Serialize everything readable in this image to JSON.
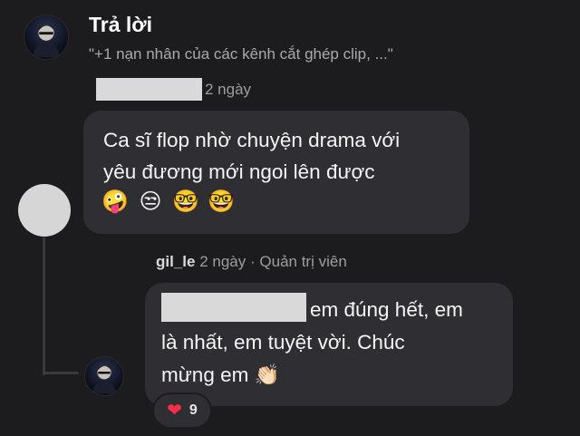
{
  "header": {
    "title": "Trả lời",
    "subtitle": "\"+1 nạn nhân của các kênh cắt ghép clip, ...\""
  },
  "comment": {
    "time": "2 ngày",
    "text_line1": "Ca sĩ flop nhờ chuyện drama với",
    "text_line2": "yêu đương mới ngoi lên được",
    "emojis": [
      "🤪",
      "😒",
      "🤓",
      "🤓"
    ]
  },
  "reply": {
    "username": "gil_le",
    "time": "2 ngày",
    "separator": "·",
    "role": "Quản trị viên",
    "text_line1": "em đúng hết, em",
    "text_line2": "là nhất, em tuyệt vời. Chúc",
    "text_line3": "mừng em",
    "emoji": "👏🏻",
    "reactions": {
      "icon": "heart-icon",
      "heart": "❤",
      "count": "9",
      "color": "#ff2d4a"
    }
  }
}
